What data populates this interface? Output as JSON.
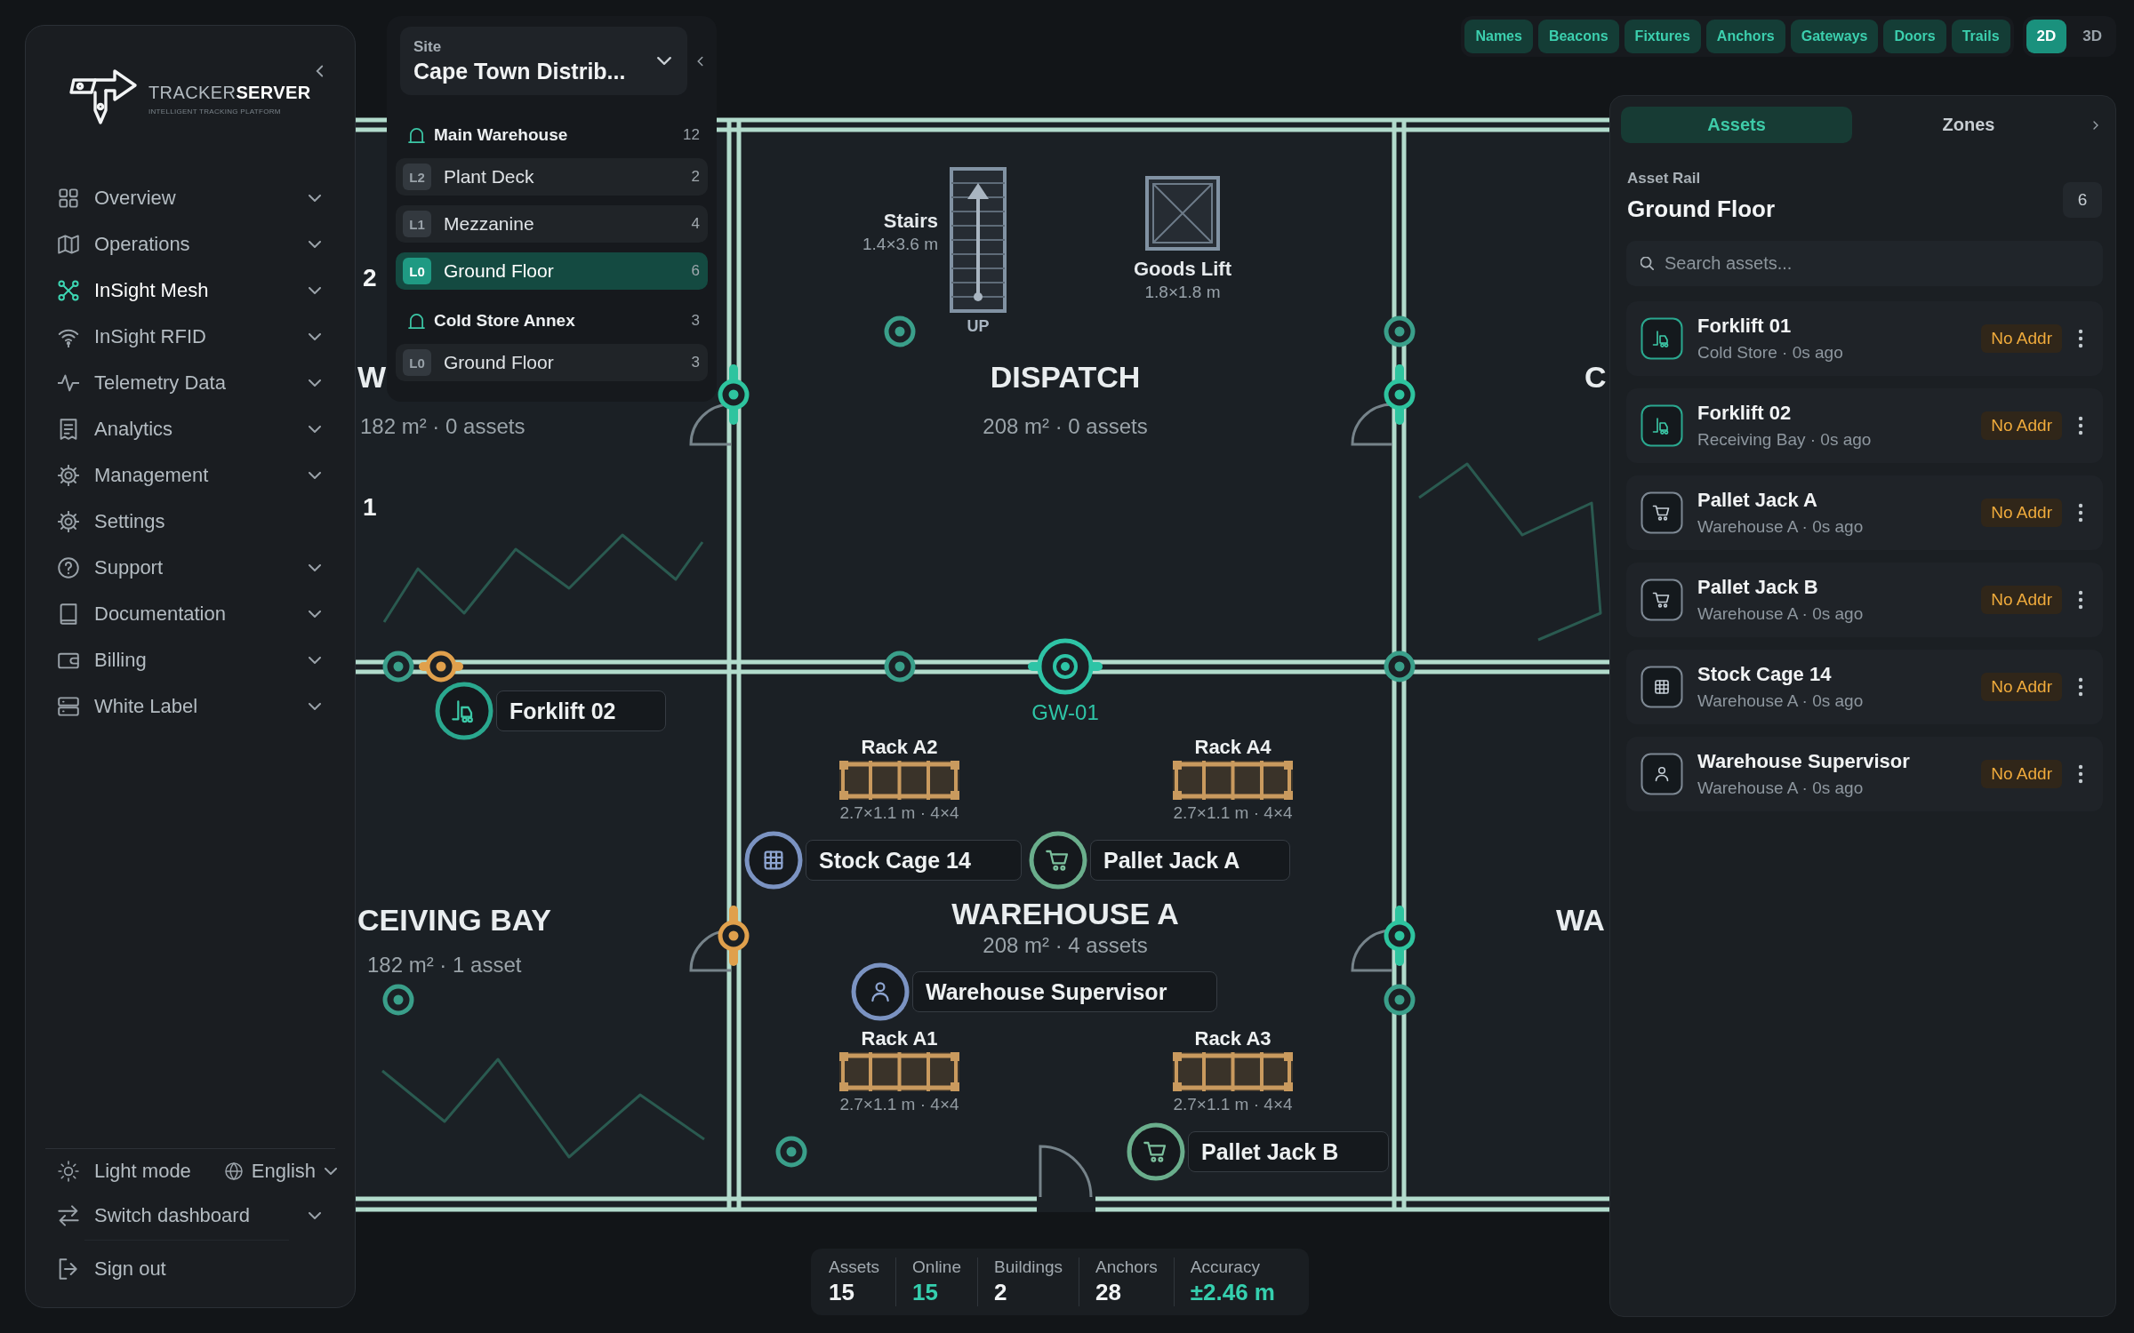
{
  "sidebar": {
    "brand": {
      "name": "TRACKER**SERVER**",
      "tagline": "INTELLIGENT TRACKING PLATFORM"
    },
    "nav": [
      {
        "label": "Overview",
        "selected": false,
        "has_submenu": true
      },
      {
        "label": "Operations",
        "selected": false,
        "has_submenu": true
      },
      {
        "label": "InSight Mesh",
        "selected": true,
        "has_submenu": true
      },
      {
        "label": "InSight RFID",
        "selected": false,
        "has_submenu": true
      },
      {
        "label": "Telemetry Data",
        "selected": false,
        "has_submenu": true
      },
      {
        "label": "Analytics",
        "selected": false,
        "has_submenu": true
      },
      {
        "label": "Management",
        "selected": false,
        "has_submenu": true
      },
      {
        "label": "Settings",
        "selected": false,
        "has_submenu": false
      },
      {
        "label": "Support",
        "selected": false,
        "has_submenu": true
      },
      {
        "label": "Documentation",
        "selected": false,
        "has_submenu": true
      },
      {
        "label": "Billing",
        "selected": false,
        "has_submenu": true
      },
      {
        "label": "White Label",
        "selected": false,
        "has_submenu": true
      }
    ],
    "theme_toggle": "Light mode",
    "language": "English",
    "switch_dashboard": "Switch dashboard",
    "sign_out": "Sign out"
  },
  "site_panel": {
    "label": "Site",
    "value": "Cape Town Distrib...",
    "buildings": [
      {
        "name": "Main Warehouse",
        "count": "12",
        "floors": [
          {
            "level": "L2",
            "name": "Plant Deck",
            "count": "2",
            "selected": false
          },
          {
            "level": "L1",
            "name": "Mezzanine",
            "count": "4",
            "selected": false
          },
          {
            "level": "L0",
            "name": "Ground Floor",
            "count": "6",
            "selected": true
          }
        ]
      },
      {
        "name": "Cold Store Annex",
        "count": "3",
        "floors": [
          {
            "level": "L0",
            "name": "Ground Floor",
            "count": "3",
            "selected": false
          }
        ]
      }
    ]
  },
  "layer_toggles": [
    {
      "label": "Names",
      "on": true
    },
    {
      "label": "Beacons",
      "on": true
    },
    {
      "label": "Fixtures",
      "on": true
    },
    {
      "label": "Anchors",
      "on": true
    },
    {
      "label": "Gateways",
      "on": true
    },
    {
      "label": "Doors",
      "on": true
    },
    {
      "label": "Trails",
      "on": true
    }
  ],
  "view_modes": [
    {
      "label": "2D",
      "selected": true
    },
    {
      "label": "3D",
      "selected": false
    }
  ],
  "map": {
    "rooms": [
      {
        "name": "W",
        "area": "182 m² · 0 assets"
      },
      {
        "name": "DISPATCH",
        "area": "208 m² · 0 assets"
      },
      {
        "name": "C"
      },
      {
        "name": "CEIVING BAY",
        "area": "182 m² · 1 asset"
      },
      {
        "name": "WAREHOUSE A",
        "area": "208 m² · 4 assets"
      },
      {
        "name": "WA"
      }
    ],
    "zone_labels": [
      "2",
      "1"
    ],
    "fixtures": [
      {
        "kind": "stairs",
        "name": "Stairs",
        "size": "1.4×3.6 m",
        "direction": "UP"
      },
      {
        "kind": "lift",
        "name": "Goods Lift",
        "size": "1.8×1.8 m"
      }
    ],
    "racks": [
      {
        "name": "Rack A2",
        "size": "2.7×1.1 m · 4×4"
      },
      {
        "name": "Rack A4",
        "size": "2.7×1.1 m · 4×4"
      },
      {
        "name": "Rack A1",
        "size": "2.7×1.1 m · 4×4"
      },
      {
        "name": "Rack A3",
        "size": "2.7×1.1 m · 4×4"
      }
    ],
    "anchors": [
      {
        "color": "#3a9f8a"
      },
      {
        "color": "#2ec49f"
      },
      {
        "color": "#3a9f8a"
      },
      {
        "color": "#2ec49f"
      },
      {
        "color": "#3a9f8a"
      },
      {
        "color": "#e0a04c"
      },
      {
        "color": "#3a9f8a"
      },
      {
        "color": "#3a9f8a"
      },
      {
        "color": "#e0a04c"
      },
      {
        "color": "#2ec49f"
      },
      {
        "color": "#3a9f8a"
      },
      {
        "color": "#3a9f8a"
      },
      {
        "color": "#3a9f8a"
      }
    ],
    "gateways": [
      {
        "label": "GW-01"
      }
    ],
    "assets": [
      {
        "name": "Forklift 02",
        "kind": "forklift"
      },
      {
        "name": "Stock Cage 14",
        "kind": "cage"
      },
      {
        "name": "Pallet Jack A",
        "kind": "pallet_jack"
      },
      {
        "name": "Warehouse Supervisor",
        "kind": "person"
      },
      {
        "name": "Pallet Jack B",
        "kind": "pallet_jack"
      }
    ]
  },
  "stats": [
    {
      "label": "Assets",
      "value": "15",
      "color": "#f1f3f4"
    },
    {
      "label": "Online",
      "value": "15",
      "color": "#35cfae"
    },
    {
      "label": "Buildings",
      "value": "2",
      "color": "#f1f3f4"
    },
    {
      "label": "Anchors",
      "value": "28",
      "color": "#f1f3f4"
    },
    {
      "label": "Accuracy",
      "value": "±2.46 m",
      "color": "#35cfae"
    }
  ],
  "asset_panel": {
    "tabs": [
      {
        "label": "Assets",
        "selected": true
      },
      {
        "label": "Zones",
        "selected": false
      }
    ],
    "eyebrow": "Asset Rail",
    "title": "Ground Floor",
    "count": "6",
    "search": {
      "placeholder": "Search assets..."
    },
    "assets": [
      {
        "name": "Forklift 01",
        "kind": "forklift",
        "detail": "Cold Store · 0s ago",
        "status": "No Addr"
      },
      {
        "name": "Forklift 02",
        "kind": "forklift",
        "detail": "Receiving Bay · 0s ago",
        "status": "No Addr"
      },
      {
        "name": "Pallet Jack A",
        "kind": "pallet_jack",
        "detail": "Warehouse A · 0s ago",
        "status": "No Addr"
      },
      {
        "name": "Pallet Jack B",
        "kind": "pallet_jack",
        "detail": "Warehouse A · 0s ago",
        "status": "No Addr"
      },
      {
        "name": "Stock Cage 14",
        "kind": "cage",
        "detail": "Warehouse A · 0s ago",
        "status": "No Addr"
      },
      {
        "name": "Warehouse Supervisor",
        "kind": "person",
        "detail": "Warehouse A · 0s ago",
        "status": "No Addr"
      }
    ]
  }
}
